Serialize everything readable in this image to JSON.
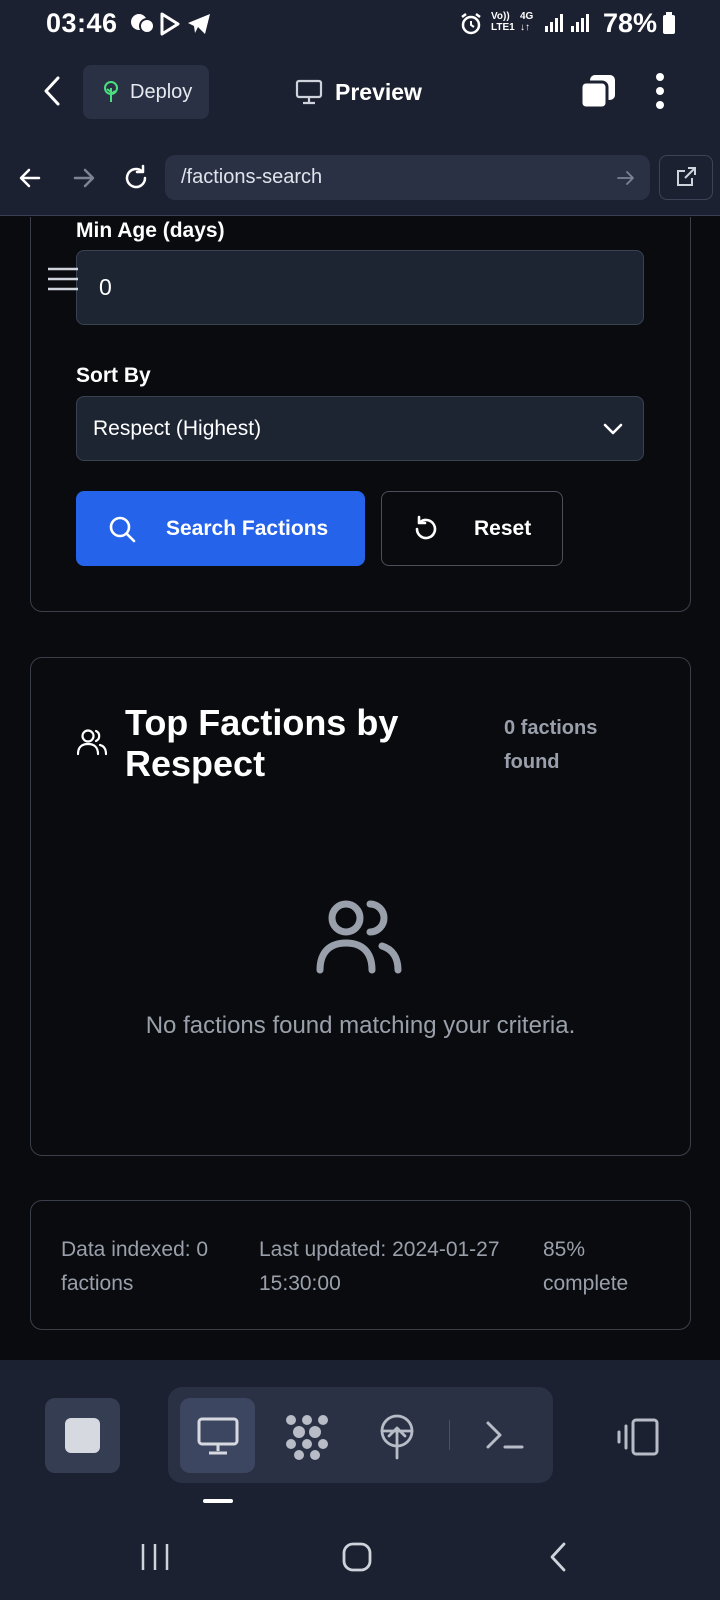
{
  "status_bar": {
    "time": "03:46",
    "battery_text": "78%",
    "network_4g": "4G",
    "network_volte": "Vo))",
    "network_lte": "LTE1"
  },
  "app_bar": {
    "deploy_label": "Deploy",
    "preview_label": "Preview"
  },
  "browser": {
    "url": "/factions-search"
  },
  "form": {
    "min_age_label": "Min Age (days)",
    "min_age_value": "0",
    "sort_label": "Sort By",
    "sort_value": "Respect (Highest)",
    "search_button": "Search Factions",
    "reset_button": "Reset"
  },
  "results": {
    "title": "Top Factions by Respect",
    "count_text": "0 factions found",
    "empty_message": "No factions found matching your criteria."
  },
  "stats": {
    "indexed": "Data indexed: 0 factions",
    "last_updated": "Last updated: 2024-01-27 15:30:00",
    "progress": "85% complete"
  },
  "colors": {
    "accent": "#2563eb",
    "chrome_bg": "#1c2131",
    "page_bg": "#0a0b0e",
    "muted_text": "#9aa0ab"
  },
  "icons": {
    "status": [
      "chat-icon",
      "play-store-icon",
      "telegram-icon",
      "alarm-icon",
      "signal-icon",
      "battery-icon"
    ],
    "app_bar": [
      "back-chevron-icon",
      "deploy-tree-icon",
      "monitor-icon",
      "tabs-icon",
      "more-vertical-icon"
    ],
    "browser": [
      "arrow-left-icon",
      "arrow-right-icon",
      "refresh-icon",
      "go-arrow-icon",
      "external-link-icon"
    ],
    "toolbar": [
      "stop-icon",
      "monitor-icon",
      "workflow-icon",
      "deploy-icon",
      "terminal-icon",
      "device-icon"
    ],
    "system": [
      "recents-icon",
      "home-icon",
      "back-icon"
    ]
  }
}
